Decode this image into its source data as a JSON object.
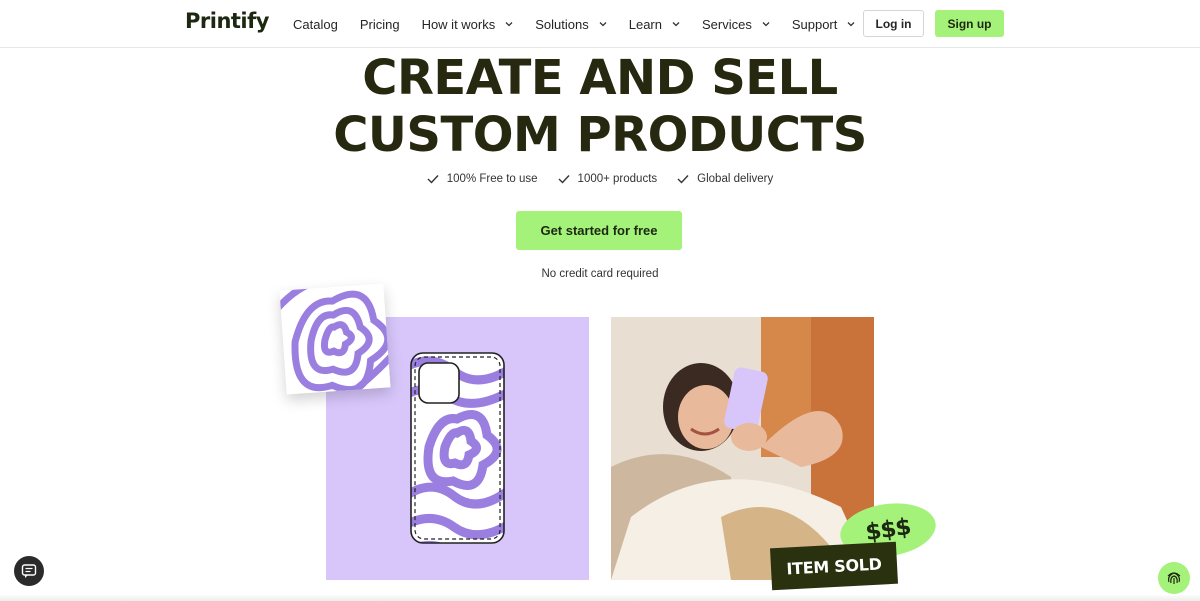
{
  "brand": {
    "logo": "Printify",
    "accent": "#a4f27a",
    "dark": "#26280f"
  },
  "nav": {
    "items": [
      {
        "label": "Catalog",
        "dropdown": false
      },
      {
        "label": "Pricing",
        "dropdown": false
      },
      {
        "label": "How it works",
        "dropdown": true
      },
      {
        "label": "Solutions",
        "dropdown": true
      },
      {
        "label": "Learn",
        "dropdown": true
      },
      {
        "label": "Services",
        "dropdown": true
      },
      {
        "label": "Support",
        "dropdown": true
      }
    ],
    "login_label": "Log in",
    "signup_label": "Sign up"
  },
  "hero": {
    "title_line1": "CREATE AND SELL",
    "title_line2": "CUSTOM PRODUCTS",
    "features": [
      "100% Free to use",
      "1000+ products",
      "Global delivery"
    ],
    "cta_label": "Get started for free",
    "note": "No credit card required"
  },
  "showcase": {
    "panel_color": "#d8c6fb",
    "pattern_color": "#9b7fe0",
    "money_badge": "$$$",
    "sold_badge": "ITEM SOLD"
  },
  "icons": {
    "check": "check-icon",
    "chevron": "chevron-down-icon",
    "chat": "chat-icon",
    "fingerprint": "fingerprint-icon"
  }
}
